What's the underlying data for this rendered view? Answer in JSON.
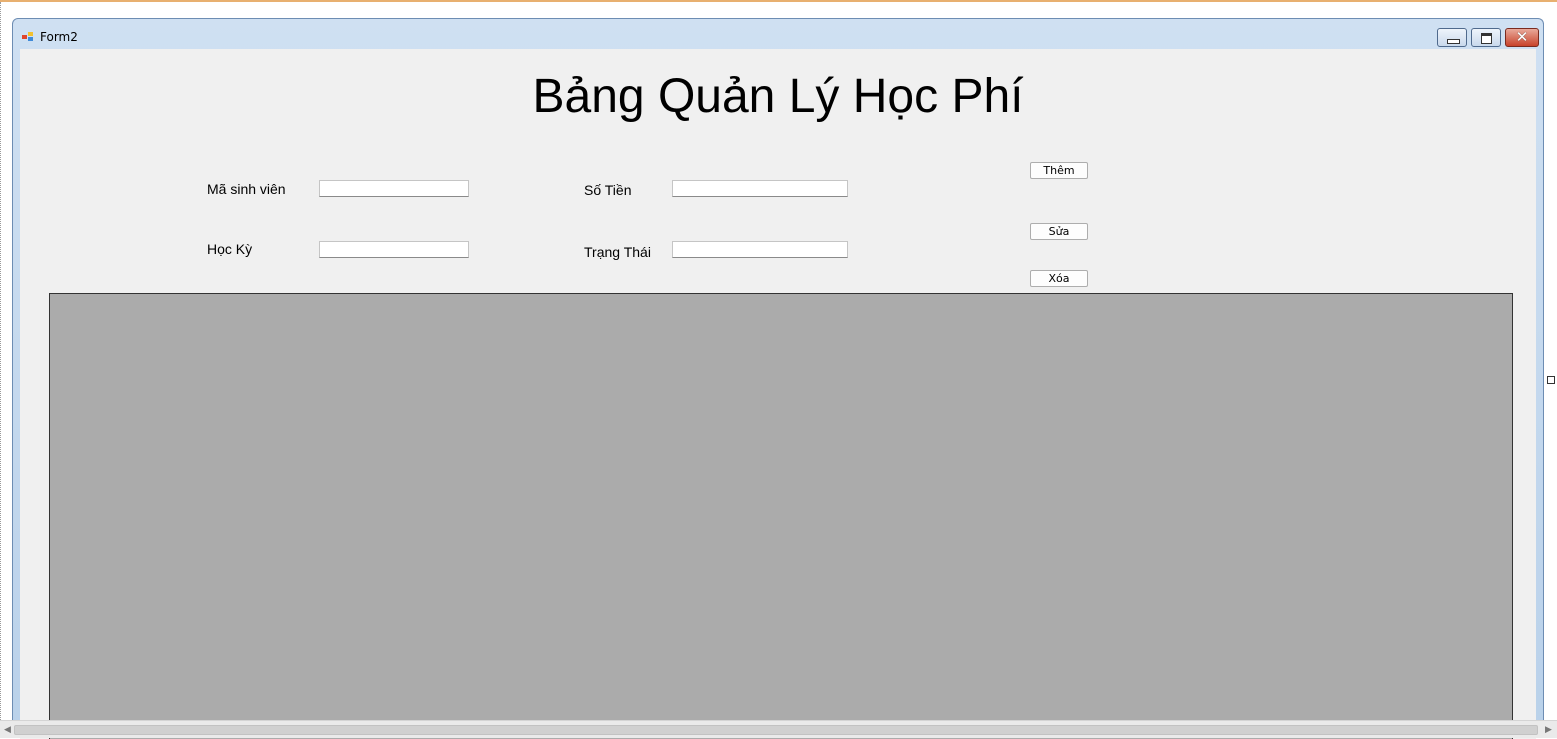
{
  "window": {
    "title": "Form2",
    "icon": "form-icon",
    "controls": {
      "minimize": "minimize-icon",
      "maximize": "maximize-icon",
      "close": "✕"
    }
  },
  "form": {
    "heading": "Bảng Quản Lý Học Phí",
    "fields": {
      "student_id": {
        "label": "Mã sinh viên",
        "value": ""
      },
      "amount": {
        "label": "Số Tiền",
        "value": ""
      },
      "semester": {
        "label": "Học Kỳ",
        "value": ""
      },
      "status": {
        "label": "Trạng Thái",
        "value": ""
      }
    },
    "buttons": {
      "add": "Thêm",
      "edit": "Sửa",
      "delete": "Xóa"
    }
  },
  "grid": {
    "rows": []
  },
  "colors": {
    "client_bg": "#f0f0f0",
    "grid_bg": "#ababab",
    "title_gradient": [
      "#cfe0f2",
      "#b9d1ea"
    ]
  }
}
